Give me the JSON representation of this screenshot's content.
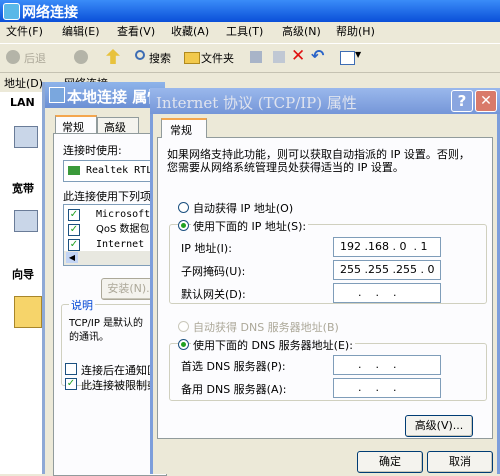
{
  "back_window": {
    "title": "网络连接",
    "menu": [
      "文件(F)",
      "编辑(E)",
      "查看(V)",
      "收藏(A)",
      "工具(T)",
      "高级(N)",
      "帮助(H)"
    ],
    "toolbar": {
      "back": "后退",
      "search": "搜索",
      "folders": "文件夹"
    },
    "address_label": "地址(D)",
    "address_value": "网络连接",
    "side_lan": "LAN",
    "side_broadband": "宽带",
    "side_wizard": "向导"
  },
  "local_conn": {
    "title": "本地连接 属性",
    "tabs": [
      "常规",
      "高级"
    ],
    "connect_using_label": "连接时使用:",
    "adapter": "Realtek RTL",
    "items_label": "此连接使用下列项",
    "items": [
      "Microsoft",
      "QoS 数据包",
      "Internet T"
    ],
    "install_button": "安装(N)...",
    "desc_group": "说明",
    "desc_text_1": "TCP/IP 是默认的",
    "desc_text_2": "的通讯。",
    "notify_check": "连接后在通知区",
    "limit_check": "此连接被限制或"
  },
  "tcpip": {
    "title": "Internet 协议 (TCP/IP) 属性",
    "tab": "常规",
    "intro_1": "如果网络支持此功能，则可以获取自动指派的 IP 设置。否则，",
    "intro_2": "您需要从网络系统管理员处获得适当的 IP 设置。",
    "auto_ip": "自动获得 IP 地址(O)",
    "manual_ip": "使用下面的 IP 地址(S):",
    "ip_label": "IP 地址(I):",
    "ip_value": "192 .168 . 0  . 1",
    "mask_label": "子网掩码(U):",
    "mask_value": "255 .255 .255 . 0",
    "gateway_label": "默认网关(D):",
    "gateway_value": ".    .    .",
    "auto_dns": "自动获得 DNS 服务器地址(B)",
    "manual_dns": "使用下面的 DNS 服务器地址(E):",
    "pref_dns_label": "首选 DNS 服务器(P):",
    "pref_dns_value": ".    .    .",
    "alt_dns_label": "备用 DNS 服务器(A):",
    "alt_dns_value": ".    .    .",
    "advanced_button": "高级(V)...",
    "ok_button": "确定",
    "cancel_button": "取消",
    "help_glyph": "?",
    "close_glyph": "✕"
  }
}
